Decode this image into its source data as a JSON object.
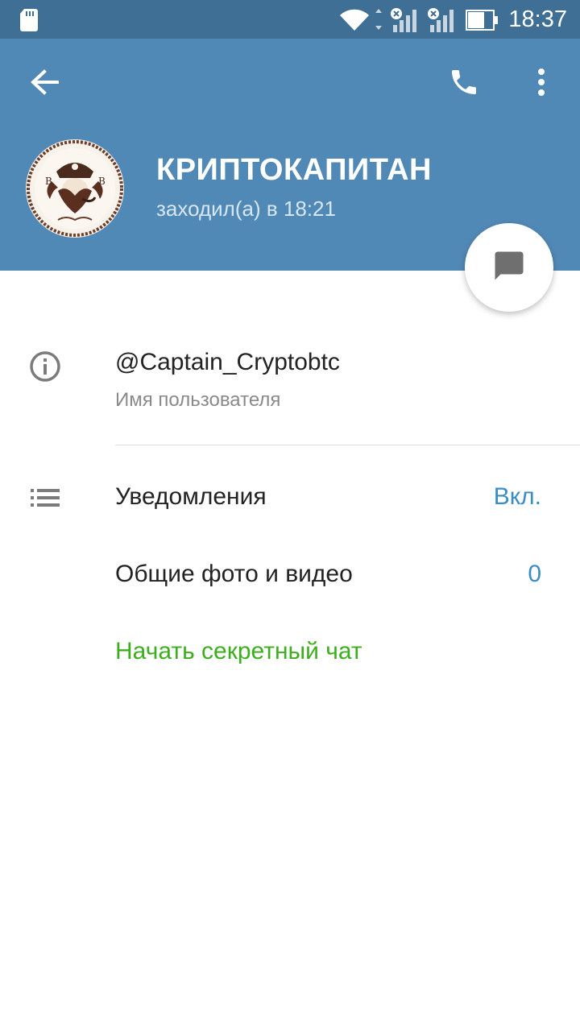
{
  "status_bar": {
    "time": "18:37",
    "icons": [
      "sd-card-icon",
      "wifi-icon",
      "signal-icon",
      "signal-icon",
      "battery-icon"
    ]
  },
  "header": {
    "icons": [
      "back-arrow-icon",
      "phone-icon",
      "more-vert-icon"
    ],
    "name": "КРИПТОКАПИТАН",
    "last_seen": "заходил(а) в 18:21",
    "background": "#5189b6",
    "fab_icon": "chat-bubble-icon"
  },
  "info": {
    "icon": "info-icon",
    "username": "@Captain_Cryptobtc",
    "username_label": "Имя пользователя"
  },
  "settings": {
    "notifications": {
      "icon": "list-icon",
      "label": "Уведомления",
      "value": "Вкл."
    },
    "shared_media": {
      "label": "Общие фото и видео",
      "value": "0"
    },
    "secret_chat": {
      "label": "Начать секретный чат"
    }
  },
  "colors": {
    "accent": "#3a8cc4",
    "secret": "#3dae1e"
  }
}
